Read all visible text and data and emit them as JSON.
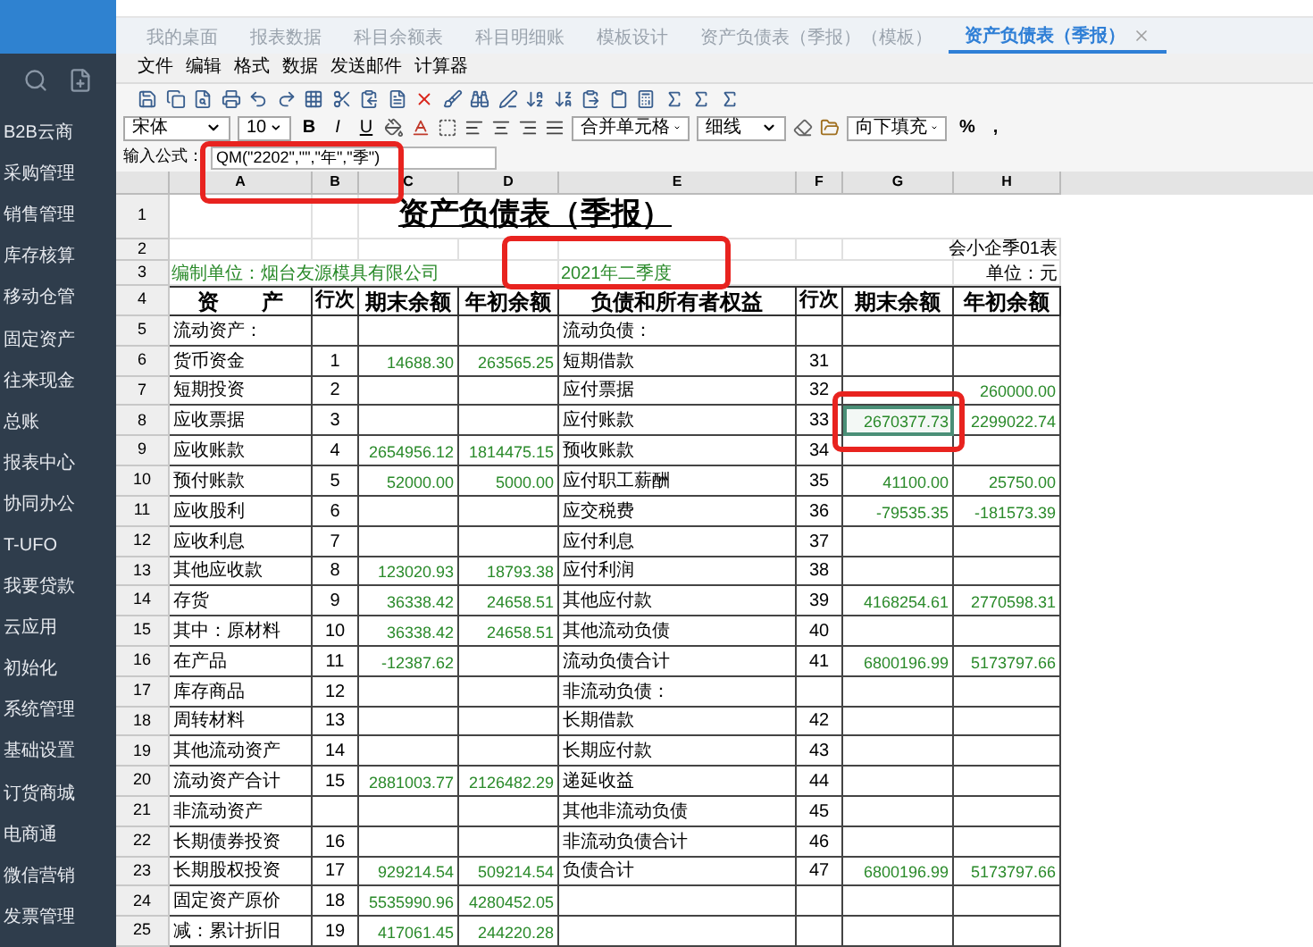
{
  "sidebar": {
    "items": [
      "B2B云商",
      "采购管理",
      "销售管理",
      "库存核算",
      "移动仓管",
      "固定资产",
      "往来现金",
      "总账",
      "报表中心",
      "协同办公",
      "T-UFO",
      "我要贷款",
      "云应用",
      "初始化",
      "系统管理",
      "基础设置",
      "订货商城",
      "电商通",
      "微信营销",
      "发票管理"
    ]
  },
  "tabs": [
    {
      "label": "我的桌面",
      "selected": false,
      "closable": false
    },
    {
      "label": "报表数据",
      "selected": false,
      "closable": false
    },
    {
      "label": "科目余额表",
      "selected": false,
      "closable": false
    },
    {
      "label": "科目明细账",
      "selected": false,
      "closable": false
    },
    {
      "label": "模板设计",
      "selected": false,
      "closable": false
    },
    {
      "label": "资产负债表（季报）（模板）",
      "selected": false,
      "closable": false
    },
    {
      "label": "资产负债表（季报）",
      "selected": true,
      "closable": true
    }
  ],
  "menu": [
    "文件",
    "编辑",
    "格式",
    "数据",
    "发送邮件",
    "计算器"
  ],
  "format_bar": {
    "font": "宋体",
    "size": "10",
    "style_buttons": [
      "B",
      "I",
      "U"
    ],
    "merge": "合并单元格",
    "border": "细线",
    "fill": "向下填充",
    "number_buttons": [
      "%",
      ","
    ]
  },
  "formula_bar": {
    "label": "输入公式：",
    "value": "QM(\"2202\",\"\",\"年\",\"季\")"
  },
  "sheet": {
    "columns": [
      "A",
      "B",
      "C",
      "D",
      "E",
      "F",
      "G",
      "H"
    ],
    "rows": [
      {
        "num": "1",
        "kind": "title",
        "cells": [
          "",
          "",
          "资产负债表（季报）"
        ]
      },
      {
        "num": "2",
        "kind": "blank",
        "cells": [
          "",
          "",
          "",
          "",
          "",
          "",
          "",
          "会小企季01表"
        ]
      },
      {
        "num": "3",
        "kind": "info",
        "cells": [
          "编制单位：烟台友源模具有限公司",
          "",
          "",
          "",
          "2021年二季度",
          "",
          "",
          "单位：元"
        ]
      },
      {
        "num": "4",
        "kind": "header",
        "cells": [
          "资　　产",
          "行次",
          "期末余额",
          "年初余额",
          "负债和所有者权益",
          "行次",
          "期末余额",
          "年初余额"
        ]
      },
      {
        "num": "5",
        "kind": "data",
        "cells": [
          "流动资产：",
          "",
          "",
          "",
          "流动负债：",
          "",
          "",
          ""
        ]
      },
      {
        "num": "6",
        "kind": "data",
        "cells": [
          "货币资金",
          "1",
          "14688.30",
          "263565.25",
          "短期借款",
          "31",
          "",
          ""
        ]
      },
      {
        "num": "7",
        "kind": "data",
        "cells": [
          "短期投资",
          "2",
          "",
          "",
          "应付票据",
          "32",
          "",
          "260000.00"
        ]
      },
      {
        "num": "8",
        "kind": "data",
        "cells": [
          "应收票据",
          "3",
          "",
          "",
          "应付账款",
          "33",
          {
            "text": "2670377.73",
            "selected": true
          },
          "2299022.74"
        ]
      },
      {
        "num": "9",
        "kind": "data",
        "cells": [
          "应收账款",
          "4",
          "2654956.12",
          "1814475.15",
          "预收账款",
          "34",
          "",
          ""
        ]
      },
      {
        "num": "10",
        "kind": "data",
        "cells": [
          "预付账款",
          "5",
          "52000.00",
          "5000.00",
          "应付职工薪酬",
          "35",
          "41100.00",
          "25750.00"
        ]
      },
      {
        "num": "11",
        "kind": "data",
        "cells": [
          "应收股利",
          "6",
          "",
          "",
          "应交税费",
          "36",
          "-79535.35",
          "-181573.39"
        ]
      },
      {
        "num": "12",
        "kind": "data",
        "cells": [
          "应收利息",
          "7",
          "",
          "",
          "应付利息",
          "37",
          "",
          ""
        ]
      },
      {
        "num": "13",
        "kind": "data",
        "cells": [
          "其他应收款",
          "8",
          "123020.93",
          "18793.38",
          "应付利润",
          "38",
          "",
          ""
        ]
      },
      {
        "num": "14",
        "kind": "data",
        "cells": [
          "存货",
          "9",
          "36338.42",
          "24658.51",
          "其他应付款",
          "39",
          "4168254.61",
          "2770598.31"
        ]
      },
      {
        "num": "15",
        "kind": "data",
        "cells": [
          "其中：原材料",
          "10",
          "36338.42",
          "24658.51",
          "其他流动负债",
          "40",
          "",
          ""
        ]
      },
      {
        "num": "16",
        "kind": "data",
        "cells": [
          "在产品",
          "11",
          "-12387.62",
          "",
          "流动负债合计",
          "41",
          "6800196.99",
          "5173797.66"
        ]
      },
      {
        "num": "17",
        "kind": "data",
        "cells": [
          "库存商品",
          "12",
          "",
          "",
          "非流动负债：",
          "",
          "",
          ""
        ]
      },
      {
        "num": "18",
        "kind": "data",
        "cells": [
          "周转材料",
          "13",
          "",
          "",
          "长期借款",
          "42",
          "",
          ""
        ]
      },
      {
        "num": "19",
        "kind": "data",
        "cells": [
          "其他流动资产",
          "14",
          "",
          "",
          "长期应付款",
          "43",
          "",
          ""
        ]
      },
      {
        "num": "20",
        "kind": "data",
        "cells": [
          "流动资产合计",
          "15",
          "2881003.77",
          "2126482.29",
          "递延收益",
          "44",
          "",
          ""
        ]
      },
      {
        "num": "21",
        "kind": "data",
        "cells": [
          "非流动资产",
          "",
          "",
          "",
          "其他非流动负债",
          "45",
          "",
          ""
        ]
      },
      {
        "num": "22",
        "kind": "data",
        "cells": [
          "长期债券投资",
          "16",
          "",
          "",
          "非流动负债合计",
          "46",
          "",
          ""
        ]
      },
      {
        "num": "23",
        "kind": "data",
        "cells": [
          "长期股权投资",
          "17",
          "929214.54",
          "509214.54",
          "负债合计",
          "47",
          "6800196.99",
          "5173797.66"
        ]
      },
      {
        "num": "24",
        "kind": "data",
        "cells": [
          "固定资产原价",
          "18",
          "5535990.96",
          "4280452.05",
          "",
          "",
          "",
          ""
        ]
      },
      {
        "num": "25",
        "kind": "data",
        "cells": [
          "减：累计折旧",
          "19",
          "417061.45",
          "244220.28",
          "",
          "",
          "",
          ""
        ]
      }
    ]
  }
}
